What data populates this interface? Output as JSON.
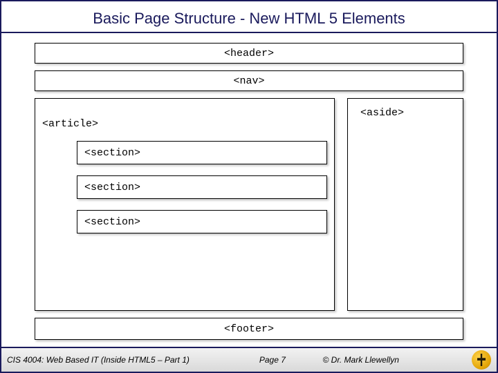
{
  "title": "Basic Page Structure - New HTML 5 Elements",
  "diagram": {
    "header": "<header>",
    "nav": "<nav>",
    "article": "<article>",
    "sections": [
      "<section>",
      "<section>",
      "<section>"
    ],
    "aside": "<aside>",
    "footer": "<footer>"
  },
  "footer": {
    "left": "CIS 4004: Web Based IT (Inside HTML5 – Part 1)",
    "mid": "Page 7",
    "right": "© Dr. Mark Llewellyn"
  }
}
